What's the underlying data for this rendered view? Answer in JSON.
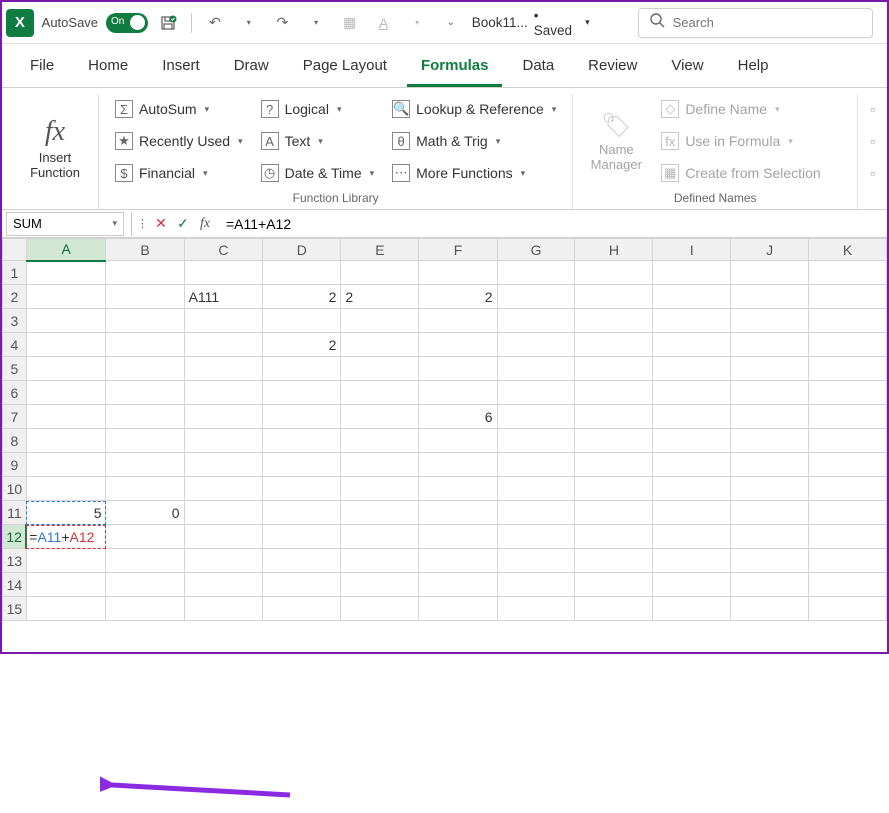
{
  "titlebar": {
    "autosave_label": "AutoSave",
    "autosave_state": "On",
    "doc_name": "Book11...",
    "doc_status": "• Saved",
    "search_placeholder": "Search"
  },
  "tabs": {
    "file": "File",
    "home": "Home",
    "insert": "Insert",
    "draw": "Draw",
    "pagelayout": "Page Layout",
    "formulas": "Formulas",
    "data": "Data",
    "review": "Review",
    "view": "View",
    "help": "Help",
    "active": "Formulas"
  },
  "ribbon": {
    "insert_function": "Insert\nFunction",
    "function_library": {
      "autosum": "AutoSum",
      "recently_used": "Recently Used",
      "financial": "Financial",
      "logical": "Logical",
      "text": "Text",
      "datetime": "Date & Time",
      "lookup": "Lookup & Reference",
      "mathtrig": "Math & Trig",
      "more": "More Functions",
      "group_label": "Function Library"
    },
    "name_manager": "Name\nManager",
    "defined_names": {
      "define_name": "Define Name",
      "use_in_formula": "Use in Formula",
      "create_selection": "Create from Selection",
      "group_label": "Defined Names"
    }
  },
  "formula_bar": {
    "name_box": "SUM",
    "formula": "=A11+A12"
  },
  "grid": {
    "columns": [
      "A",
      "B",
      "C",
      "D",
      "E",
      "F",
      "G",
      "H",
      "I",
      "J",
      "K"
    ],
    "rows": [
      "1",
      "2",
      "3",
      "4",
      "5",
      "6",
      "7",
      "8",
      "9",
      "10",
      "11",
      "12",
      "13",
      "14",
      "15"
    ],
    "cells": {
      "C2": "A111",
      "D2": "2",
      "E2": "2",
      "F2": "2",
      "D4": "2",
      "F7": "6",
      "A11": "5",
      "B11": "0",
      "A12_formula_prefix": "=",
      "A12_ref1": "A11",
      "A12_plus": "+",
      "A12_ref2": "A12"
    }
  }
}
